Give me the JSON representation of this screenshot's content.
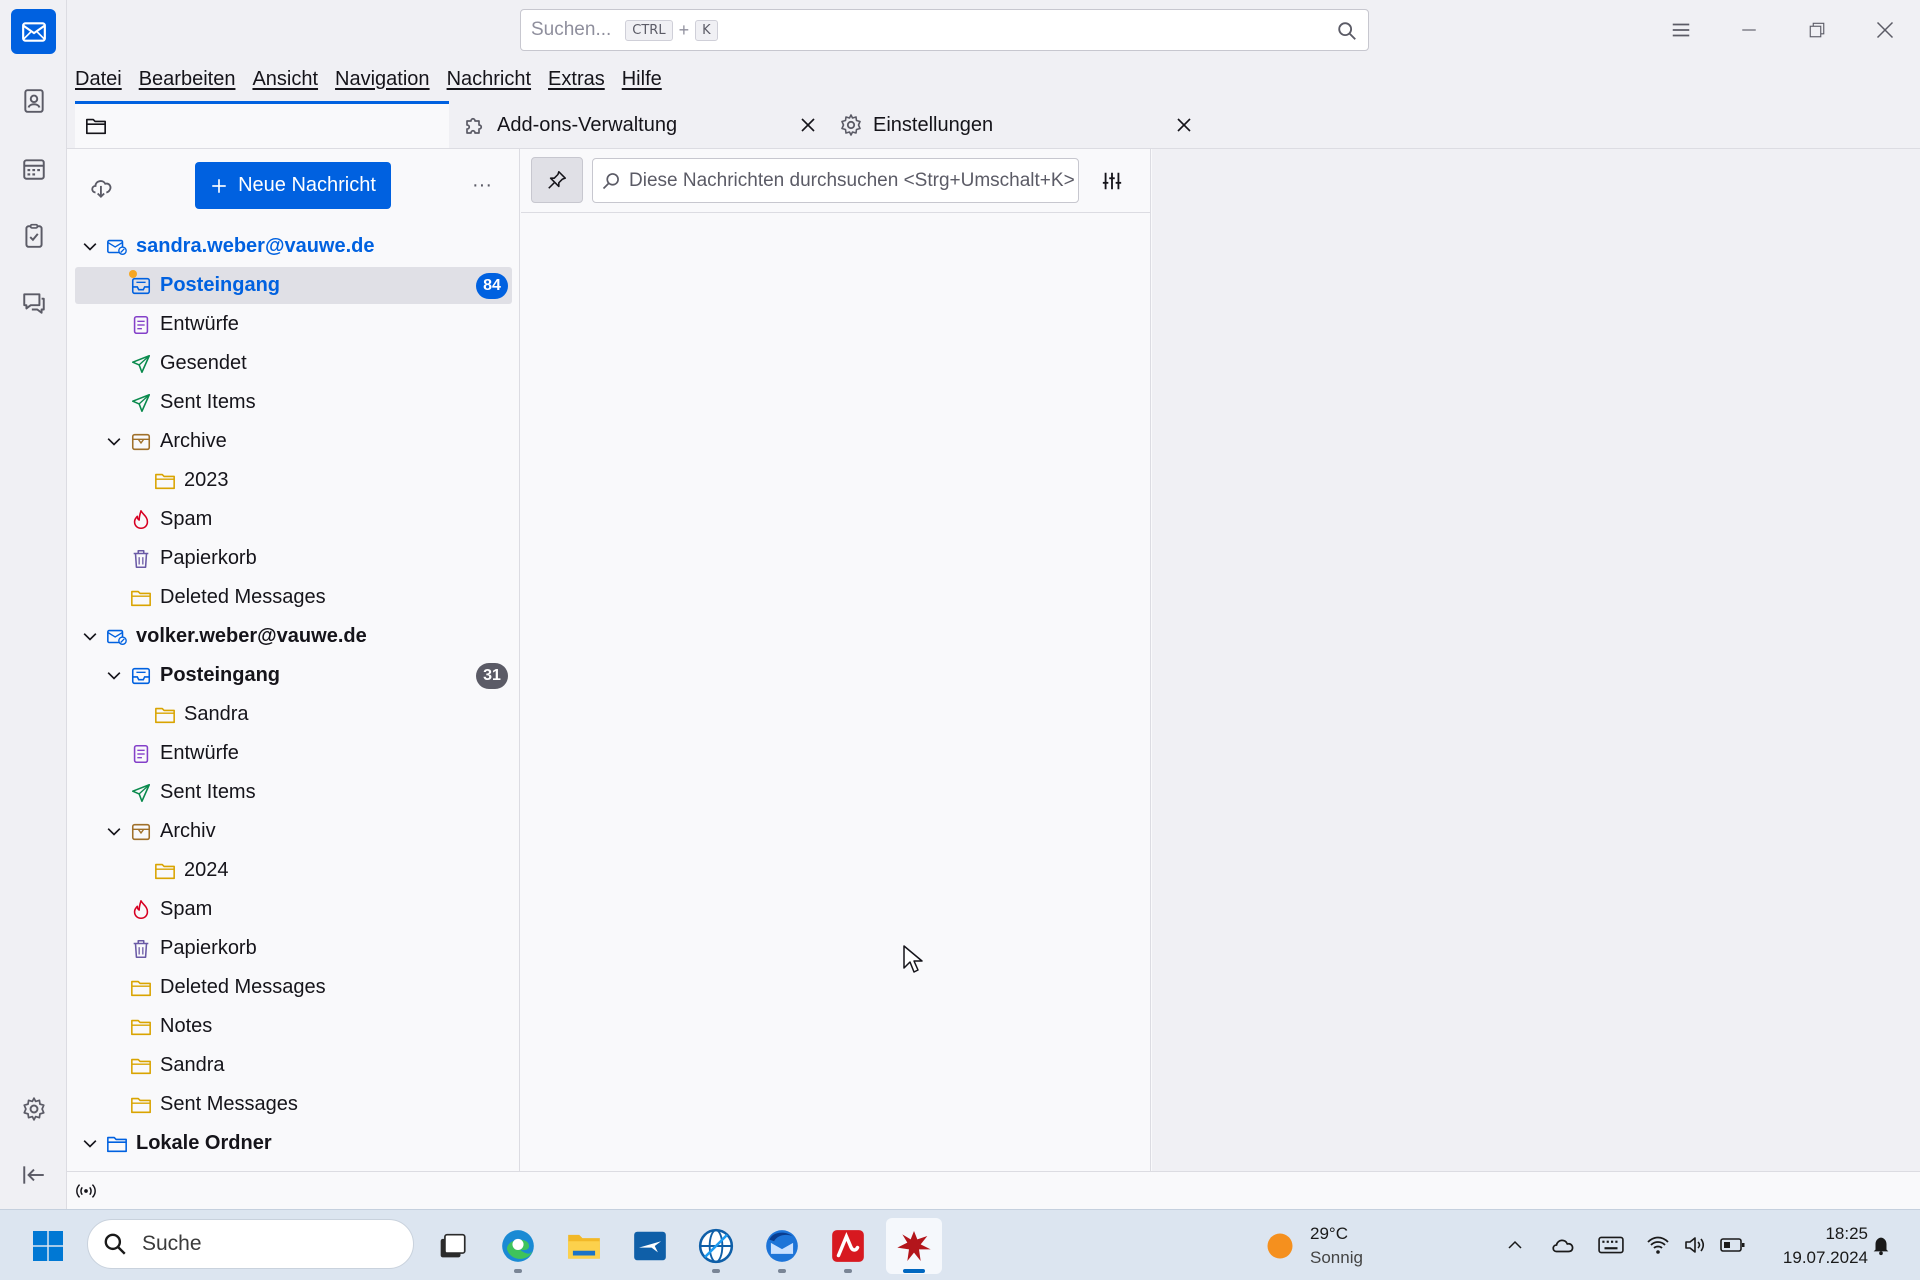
{
  "titlebar": {
    "search_placeholder": "Suchen...",
    "search_kbd1": "CTRL",
    "search_plus": "+",
    "search_kbd2": "K"
  },
  "menubar": {
    "items": [
      "Datei",
      "Bearbeiten",
      "Ansicht",
      "Navigation",
      "Nachricht",
      "Extras",
      "Hilfe"
    ]
  },
  "tabs": [
    {
      "label": "",
      "icon": "folder-icon",
      "selected": true
    },
    {
      "label": "Add-ons-Verwaltung",
      "icon": "puzzle-icon",
      "selected": false
    },
    {
      "label": "Einstellungen",
      "icon": "gear-icon",
      "selected": false
    }
  ],
  "folderpane": {
    "new_message_label": "Neue Nachricht",
    "more_label": "···",
    "accounts": [
      {
        "name": "sandra.weber@vauwe.de",
        "folders": [
          {
            "label": "Posteingang",
            "badge": "84",
            "selected": true
          },
          {
            "label": "Entwürfe"
          },
          {
            "label": "Gesendet"
          },
          {
            "label": "Sent Items"
          },
          {
            "label": "Archive"
          },
          {
            "label": "2023"
          },
          {
            "label": "Spam"
          },
          {
            "label": "Papierkorb"
          },
          {
            "label": "Deleted Messages"
          }
        ]
      },
      {
        "name": "volker.weber@vauwe.de",
        "folders": [
          {
            "label": "Posteingang",
            "badge": "31"
          },
          {
            "label": "Sandra"
          },
          {
            "label": "Entwürfe"
          },
          {
            "label": "Sent Items"
          },
          {
            "label": "Archiv"
          },
          {
            "label": "2024"
          },
          {
            "label": "Spam"
          },
          {
            "label": "Papierkorb"
          },
          {
            "label": "Deleted Messages"
          },
          {
            "label": "Notes"
          },
          {
            "label": "Sandra"
          },
          {
            "label": "Sent Messages"
          }
        ]
      },
      {
        "name": "Lokale Ordner",
        "folders": []
      }
    ]
  },
  "threadpane": {
    "quick_filter_placeholder": "Diese Nachrichten durchsuchen <Strg+Umschalt+K>"
  },
  "taskbar": {
    "search_label": "Suche",
    "weather_temp": "29°C",
    "weather_desc": "Sonnig",
    "time": "18:25",
    "date": "19.07.2024"
  },
  "colors": {
    "accent": "#0061e0",
    "badge_selected": "#0061e0",
    "badge_normal": "#5b5b66"
  }
}
